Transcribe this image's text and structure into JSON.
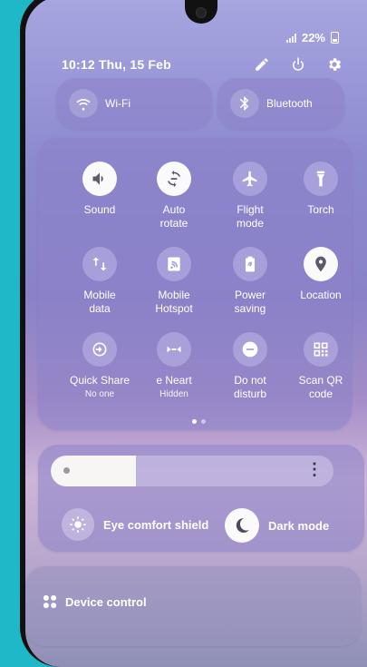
{
  "status": {
    "battery": "22%"
  },
  "header": {
    "datetime": "10:12  Thu, 15 Feb"
  },
  "toggles": {
    "wifi": "Wi-Fi",
    "bluetooth": "Bluetooth"
  },
  "tiles": [
    {
      "label": "Sound",
      "sub": "",
      "icon": "speaker-icon",
      "on": true
    },
    {
      "label": "Auto\nrotate",
      "sub": "",
      "icon": "rotate-icon",
      "on": true
    },
    {
      "label": "Flight\nmode",
      "sub": "",
      "icon": "airplane-icon",
      "on": false
    },
    {
      "label": "Torch",
      "sub": "",
      "icon": "flashlight-icon",
      "on": false
    },
    {
      "label": "Mobile\ndata",
      "sub": "",
      "icon": "mobile-data-icon",
      "on": false
    },
    {
      "label": "Mobile\nHotspot",
      "sub": "",
      "icon": "hotspot-icon",
      "on": false
    },
    {
      "label": "Power\nsaving",
      "sub": "",
      "icon": "battery-leaf-icon",
      "on": false
    },
    {
      "label": "Location",
      "sub": "",
      "icon": "location-pin-icon",
      "on": true
    },
    {
      "label": "Quick Share",
      "sub": "No one",
      "icon": "quick-share-icon",
      "on": false
    },
    {
      "label": "e    Neart",
      "sub": "Hidden",
      "icon": "nearby-icon",
      "on": false
    },
    {
      "label": "Do not\ndisturb",
      "sub": "",
      "icon": "dnd-icon",
      "on": false
    },
    {
      "label": "Scan QR\ncode",
      "sub": "",
      "icon": "qr-icon",
      "on": false
    }
  ],
  "brightness": {
    "level": 0.3
  },
  "modes": {
    "eye": "Eye comfort shield",
    "dark": "Dark mode"
  },
  "device": {
    "label": "Device control"
  }
}
